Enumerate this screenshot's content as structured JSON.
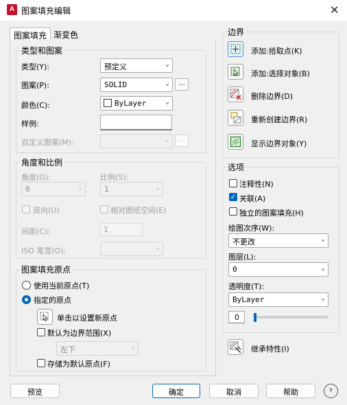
{
  "window": {
    "title": "图案填充编辑",
    "app_icon": "A"
  },
  "tabs": [
    {
      "label": "图案填充"
    },
    {
      "label": "渐变色"
    }
  ],
  "type_pattern": {
    "title": "类型和图案",
    "type_label": "类型(Y):",
    "type_value": "预定义",
    "pattern_label": "图案(P):",
    "pattern_value": "SOLID",
    "color_label": "颜色(C):",
    "color_value": "ByLayer",
    "swatch_label": "样例:",
    "custom_label": "自定义图案(M):",
    "ellipsis": "..."
  },
  "angle_scale": {
    "title": "角度和比例",
    "angle_label": "角度(G):",
    "angle_value": "0",
    "scale_label": "比例(S):",
    "scale_value": "1",
    "double_label": "双向(U)",
    "relative_label": "相对图纸空间(E)",
    "spacing_label": "间距(C):",
    "spacing_value": "1",
    "iso_label": "ISO 笔宽(O):"
  },
  "origin": {
    "title": "图案填充原点",
    "use_current": "使用当前原点(T)",
    "specified": "指定的原点",
    "click_set": "单击以设置新原点",
    "default_extents": "默认为边界范围(X)",
    "position_value": "左下",
    "store_default": "存储为默认原点(F)"
  },
  "boundaries": {
    "title": "边界",
    "add_pick": "添加:拾取点(K)",
    "add_select": "添加:选择对象(B)",
    "remove": "删除边界(D)",
    "recreate": "重新创建边界(R)",
    "view": "显示边界对象(Y)"
  },
  "options": {
    "title": "选项",
    "annotative": "注释性(N)",
    "associative": "关联(A)",
    "separate": "独立的图案填充(H)",
    "draw_order_label": "绘图次序(W):",
    "draw_order_value": "不更改",
    "layer_label": "图层(L):",
    "layer_value": "0",
    "transparency_label": "透明度(T):",
    "transparency_value": "ByLayer",
    "transparency_amount": "0",
    "transparency_level": 0
  },
  "inherit": "继承特性(I)",
  "footer": {
    "preview": "预览",
    "ok": "确定",
    "cancel": "取消",
    "help": "帮助",
    "more": "›"
  },
  "colors": {
    "accent": "#0067c0",
    "title_icon": "#c8102e"
  }
}
